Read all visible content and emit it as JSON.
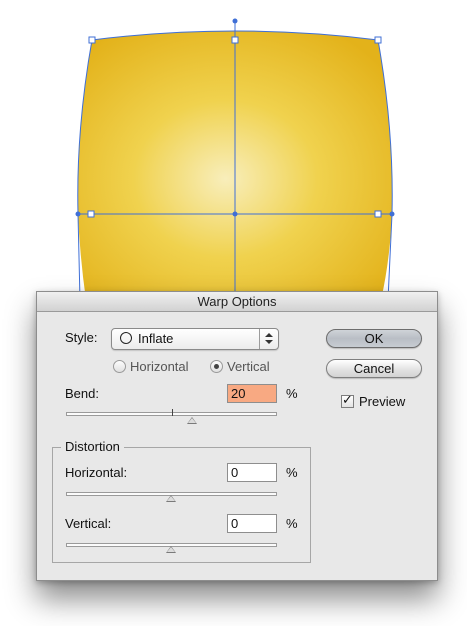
{
  "dialog": {
    "title": "Warp Options",
    "style_label": "Style:",
    "style_value": "Inflate",
    "style_icon": "inflate-circle-icon",
    "orientation": {
      "horizontal_label": "Horizontal",
      "vertical_label": "Vertical",
      "selected": "Vertical"
    },
    "bend": {
      "label": "Bend:",
      "value": "20",
      "unit": "%",
      "slider_fraction": 0.6
    },
    "distortion": {
      "group_title": "Distortion",
      "horizontal_label": "Horizontal:",
      "horizontal_value": "0",
      "horizontal_unit": "%",
      "horizontal_slider_fraction": 0.5,
      "vertical_label": "Vertical:",
      "vertical_value": "0",
      "vertical_unit": "%",
      "vertical_slider_fraction": 0.5
    },
    "buttons": {
      "ok": "OK",
      "cancel": "Cancel"
    },
    "preview": {
      "label": "Preview",
      "checked": true
    }
  },
  "colors": {
    "artwork_fill_light": "#f7ebb0",
    "artwork_fill_dark": "#e8ba1e",
    "mesh_line": "#3f6fd6",
    "bend_field_highlight": "#f8a982"
  }
}
